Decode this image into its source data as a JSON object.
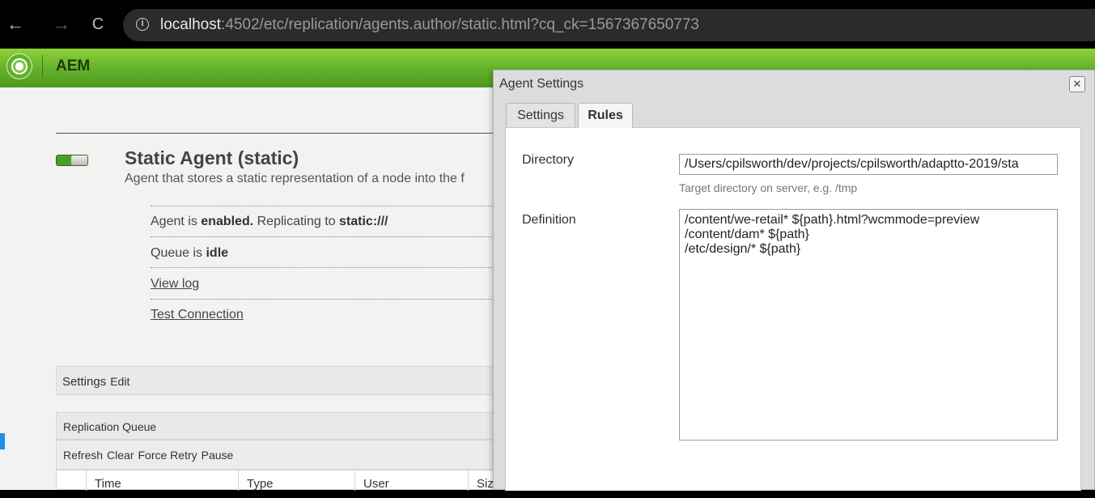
{
  "browser": {
    "url_host": "localhost",
    "url_rest": ":4502/etc/replication/agents.author/static.html?cq_ck=1567367650773",
    "back_icon": "←",
    "forward_icon": "→",
    "reload_icon": "C",
    "info_icon": "i"
  },
  "header": {
    "title": "AEM"
  },
  "agent": {
    "title": "Static Agent (static)",
    "description": "Agent that stores a static representation of a node into the f",
    "status_prefix": "Agent is ",
    "status_enabled": "enabled.",
    "status_mid": " Replicating to ",
    "status_target": "static:///",
    "queue_prefix": "Queue is ",
    "queue_state": "idle",
    "view_log": "View log",
    "test_connection": "Test Connection"
  },
  "settings_bar": {
    "label": "Settings",
    "edit": "Edit"
  },
  "queue": {
    "title": "Replication Queue",
    "actions": [
      "Refresh",
      "Clear",
      "Force Retry",
      "Pause"
    ],
    "columns": [
      "Time",
      "Type",
      "User",
      "Siz"
    ]
  },
  "dialog": {
    "title": "Agent Settings",
    "close_icon": "✕",
    "tabs": [
      "Settings",
      "Rules"
    ],
    "active_tab": "Rules",
    "directory_label": "Directory",
    "directory_value": "/Users/cpilsworth/dev/projects/cpilsworth/adaptto-2019/sta",
    "directory_hint": "Target directory on server, e.g. /tmp",
    "definition_label": "Definition",
    "definition_lines": [
      "/content/we-retail* ${path}.html?wcmmode=preview",
      "/content/dam* ${path}",
      "/etc/design/* ${path}"
    ]
  },
  "colors": {
    "header_green": "#62b02a",
    "toggle_green": "#4d9e24",
    "page_bg": "#f2f2f2"
  }
}
